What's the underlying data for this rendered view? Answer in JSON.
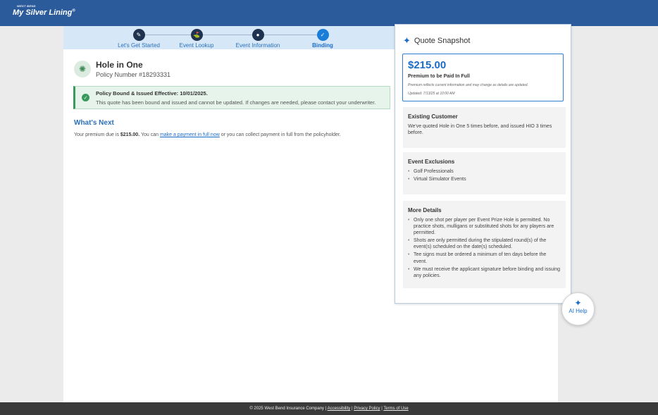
{
  "header": {
    "logo_top": "WEST BEND",
    "logo_main": "My Silver Lining",
    "logo_reg": "®"
  },
  "stepper": {
    "steps": [
      {
        "label": "Let's Get Started",
        "icon": "pencil-icon",
        "glyph": "✎"
      },
      {
        "label": "Event Lookup",
        "icon": "golf-icon",
        "glyph": "⛳"
      },
      {
        "label": "Event Information",
        "icon": "person-icon",
        "glyph": "●"
      },
      {
        "label": "Binding",
        "icon": "check-icon",
        "glyph": "✓"
      }
    ]
  },
  "policy": {
    "icon": "celebration-icon",
    "title": "Hole in One",
    "number": "Policy Number #18293331"
  },
  "alert": {
    "title": "Policy Bound & Issued Effective: 10/01/2025.",
    "body": "This quote has been bound and issued and cannot be updated. If changes are needed, please contact your underwriter."
  },
  "next": {
    "title": "What's Next",
    "prefix": "Your premium due is ",
    "amount": "$215.00.",
    "mid": " You can ",
    "link": "make a payment in full now",
    "suffix": " or you can collect payment in full from the policyholder."
  },
  "quote": {
    "title": "Quote Snapshot",
    "price": "$215.00",
    "price_label": "Premium to be Paid In Full",
    "note": "Premium reflects current information and may change as details are updated.",
    "updated": "Updated: 7/13/25 at 10:00 AM",
    "existing_title": "Existing Customer",
    "existing_body": "We've quoted Hole in One 5 times before, and issued HIO 3 times before.",
    "exclusions_title": "Event Exclusions",
    "exclusions": [
      "Golf Professionals",
      "Virtual Simulator Events"
    ],
    "details_title": "More Details",
    "details": [
      "Only one shot per player per Event Prize Hole is permitted. No practice shots, mulligans or substituted shots for any players are permitted.",
      "Shots are only permitted during the stipulated round(s) of the event(s) scheduled on the date(s) scheduled.",
      "Tee signs must be ordered a minimum of ten days before the event.",
      "We must receive the applicant signature before binding and issuing any policies."
    ]
  },
  "ai_help": {
    "label": "AI Help"
  },
  "footer": {
    "copyright": "© 2025 West Bend Insurance Company | ",
    "accessibility": "Accessibility",
    "privacy": "Privacy Policy",
    "terms": "Terms of Use",
    "sep": " | "
  },
  "colors": {
    "brand_blue": "#2c5b9c",
    "accent": "#1a6cc8",
    "success": "#3a9a5c"
  }
}
